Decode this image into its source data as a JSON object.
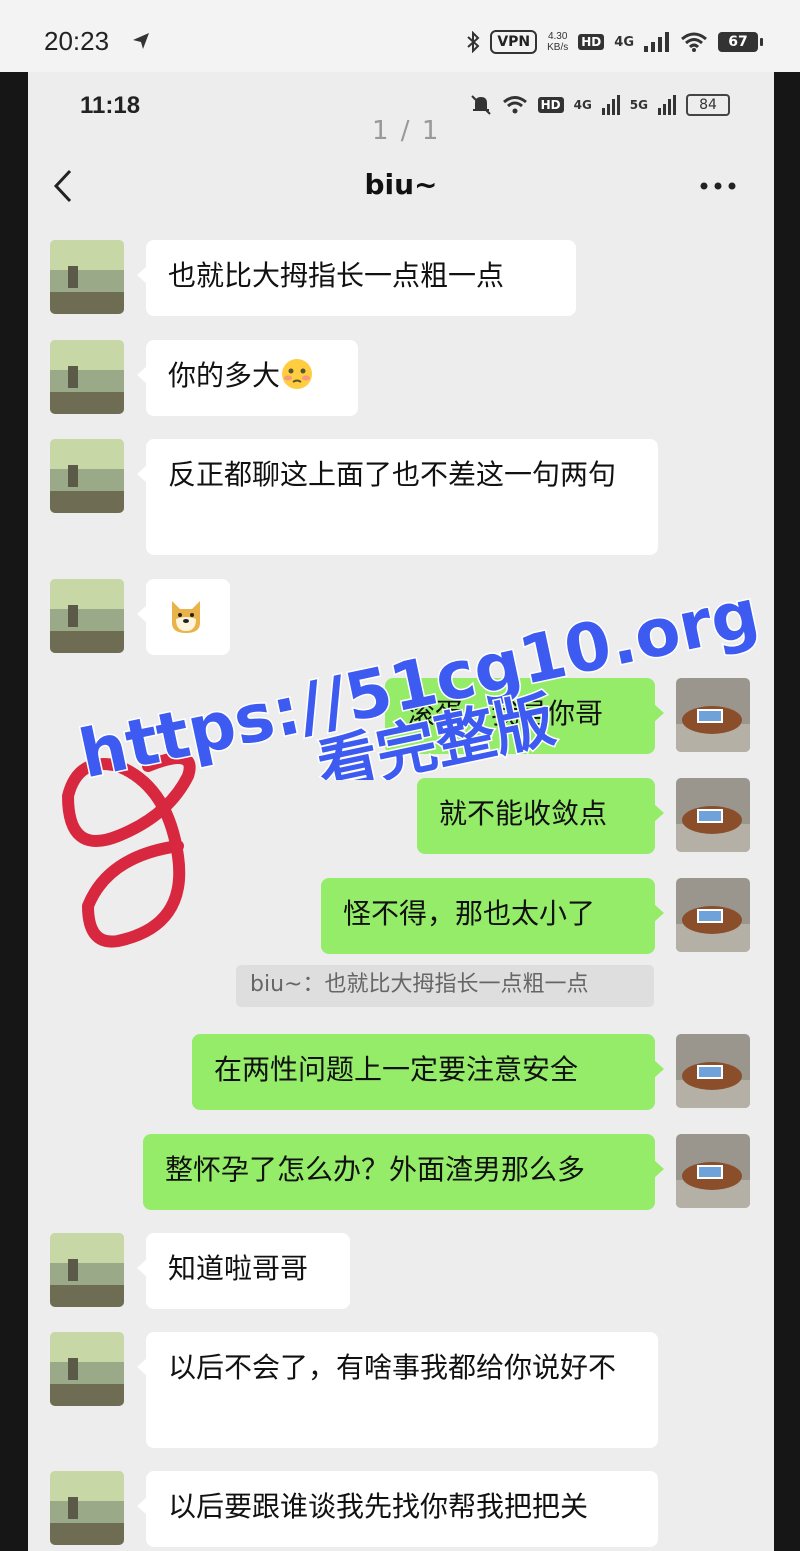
{
  "outer_status": {
    "time": "20:23",
    "vpn": "VPN",
    "speed_value": "4.30",
    "speed_unit": "KB/s",
    "hd": "HD",
    "network": "4G",
    "battery": "67"
  },
  "inner_status": {
    "time": "11:18",
    "hd": "HD",
    "net1": "4G",
    "net2": "5G",
    "battery": "84"
  },
  "page_counter": "1 / 1",
  "header": {
    "title": "biu~",
    "back_icon": "chevron-left-icon",
    "more_icon": "more-dots-icon"
  },
  "messages": [
    {
      "side": "left",
      "text": "也就比大拇指长一点粗一点"
    },
    {
      "side": "left",
      "text": "你的多大",
      "emoji": "flushed-face-emoji"
    },
    {
      "side": "left",
      "text": "反正都聊这上面了也不差这一句两句"
    },
    {
      "side": "left",
      "text": "",
      "emoji": "doge-emoji"
    },
    {
      "side": "right",
      "text": "滚蛋，我是你哥"
    },
    {
      "side": "right",
      "text": "就不能收敛点"
    },
    {
      "side": "right",
      "text": "怪不得，那也太小了"
    },
    {
      "side": "quote",
      "text": "biu~：也就比大拇指长一点粗一点"
    },
    {
      "side": "right",
      "text": "在两性问题上一定要注意安全"
    },
    {
      "side": "right",
      "text": "整怀孕了怎么办？外面渣男那么多"
    },
    {
      "side": "left",
      "text": "知道啦哥哥"
    },
    {
      "side": "left",
      "text": "以后不会了，有啥事我都给你说好不"
    },
    {
      "side": "left",
      "text": "以后要跟谁谈我先找你帮我把把关"
    }
  ],
  "watermark": {
    "line1": "https://51cg10.org",
    "line2": "看完整版",
    "color": "#3d5bf0"
  },
  "scribble": {
    "shape": "8",
    "color": "#d8283f"
  },
  "colors": {
    "bubble_right": "#95ec69",
    "bubble_left": "#ffffff",
    "background": "#ededed"
  }
}
